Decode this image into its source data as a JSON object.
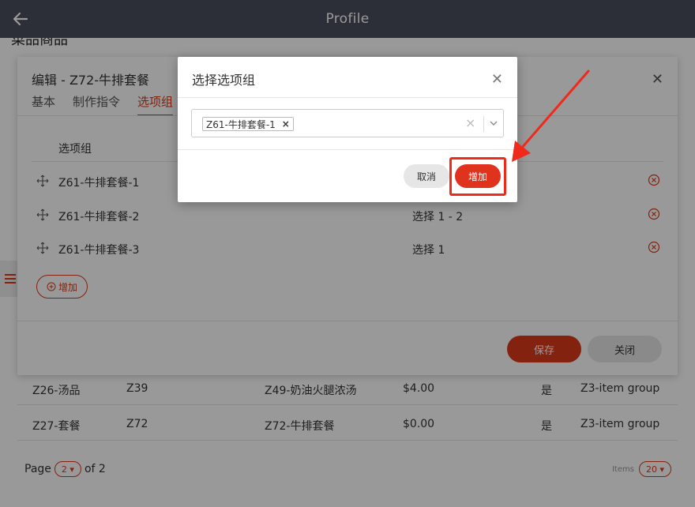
{
  "appbar": {
    "title": "Profile",
    "back_icon": "arrow-left-icon"
  },
  "page": {
    "heading": "菜品商品",
    "rows": [
      {
        "group": "Z26-汤品",
        "code": "Z39",
        "item": "Z49-奶油火腿浓汤",
        "price": "$4.00",
        "flag": "是",
        "item_group": "Z3-item group"
      },
      {
        "group": "Z27-套餐",
        "code": "Z72",
        "item": "Z72-牛排套餐",
        "price": "$0.00",
        "flag": "是",
        "item_group": "Z3-item group"
      }
    ],
    "pager": {
      "prefix": "Page",
      "page": "2",
      "suffix": "of 2",
      "items_label": "Items",
      "items_value": "20"
    }
  },
  "edit_dialog": {
    "title": "编辑 - Z72-牛排套餐",
    "tabs": [
      {
        "label": "基本"
      },
      {
        "label": "制作指令"
      },
      {
        "label": "选项组"
      }
    ],
    "column_header": "选项组",
    "rows": [
      {
        "name": "Z61-牛排套餐-1",
        "rule": ""
      },
      {
        "name": "Z61-牛排套餐-2",
        "rule": "选择 1 - 2"
      },
      {
        "name": "Z61-牛排套餐-3",
        "rule": "选择 1"
      }
    ],
    "add_label": "增加",
    "save_label": "保存",
    "close_label": "关闭"
  },
  "select_dialog": {
    "title": "选择选项组",
    "selected_chip": "Z61-牛排套餐-1",
    "chip_remove": "×",
    "clear": "×",
    "cancel_label": "取消",
    "confirm_label": "增加"
  },
  "colors": {
    "accent": "#d9391a",
    "appbar": "#4a4f5c",
    "annotation": "#f02a1a"
  }
}
